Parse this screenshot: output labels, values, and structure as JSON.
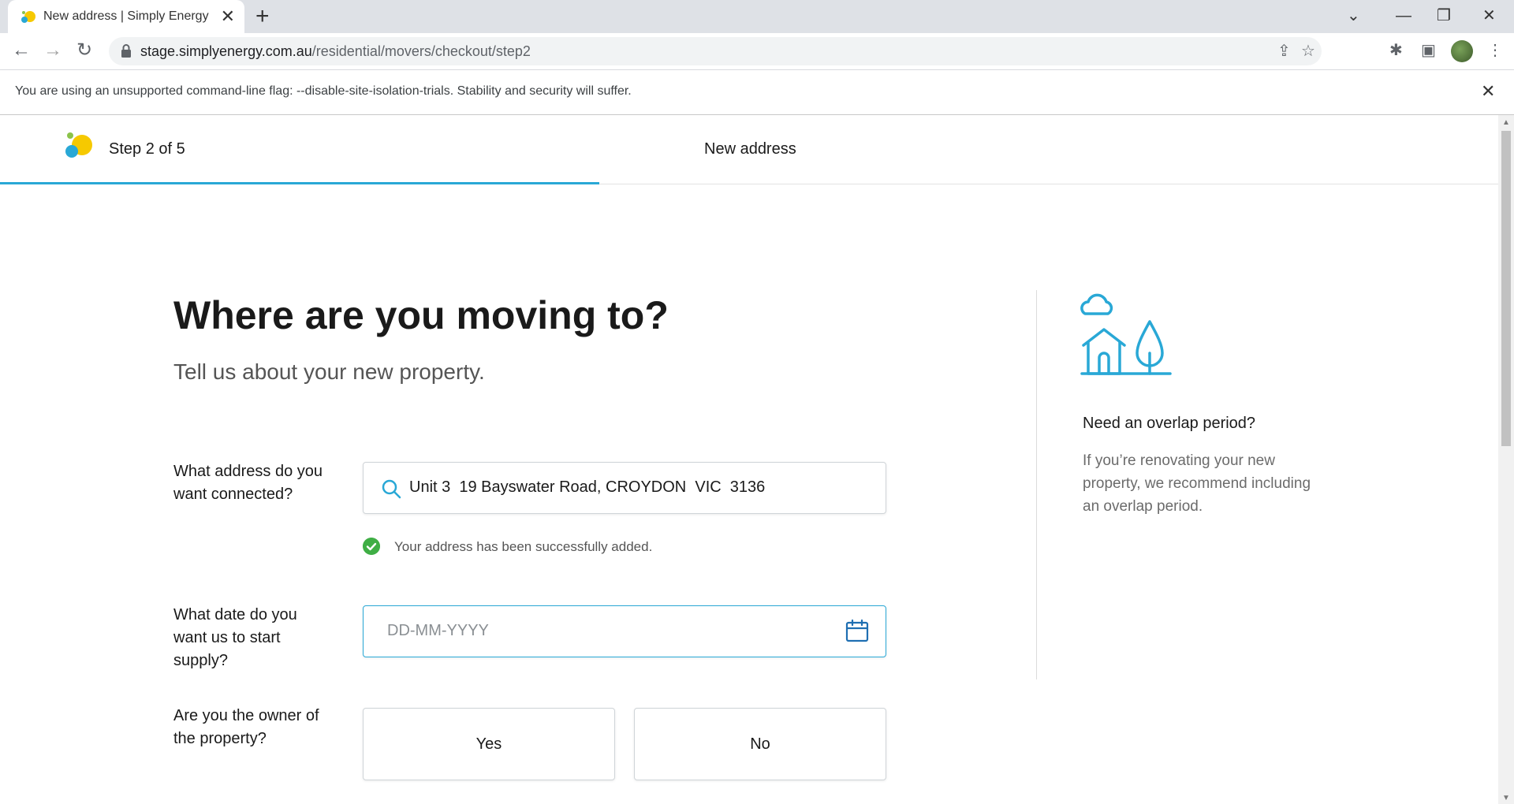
{
  "browser": {
    "tab_title": "New address | Simply Energy",
    "url_host": "stage.simplyenergy.com.au",
    "url_path": "/residential/movers/checkout/step2",
    "infobar_text": "You are using an unsupported command-line flag: --disable-site-isolation-trials. Stability and security will suffer."
  },
  "header": {
    "step": "Step 2 of 5",
    "title": "New address",
    "progress": 0.4
  },
  "main": {
    "heading": "Where are you moving to?",
    "subheading": "Tell us about your new property.",
    "address": {
      "label": "What address do you want connected?",
      "value": "Unit 3  19 Bayswater Road, CROYDON  VIC  3136",
      "success": "Your address has been successfully added."
    },
    "date": {
      "label": "What date do you want us to start supply?",
      "placeholder": "DD-MM-YYYY"
    },
    "owner": {
      "label": "Are you the owner of the property?",
      "yes": "Yes",
      "no": "No"
    }
  },
  "sidebar": {
    "title": "Need an overlap period?",
    "text": "If you’re renovating your new property, we recommend including an overlap period."
  },
  "colors": {
    "accent": "#29a8d6",
    "success": "#3fae45"
  }
}
